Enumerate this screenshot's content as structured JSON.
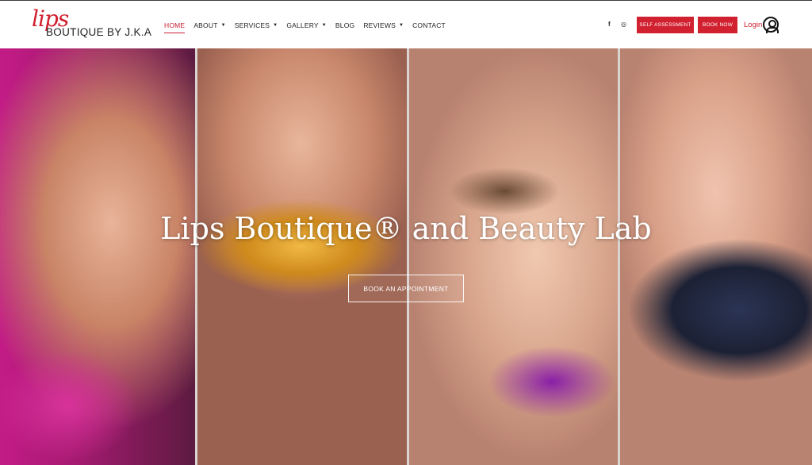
{
  "header": {
    "logo": {
      "script": "lips",
      "text": "BOUTIQUE BY J.K.A"
    },
    "nav": [
      {
        "label": "HOME",
        "has_dropdown": false,
        "active": true
      },
      {
        "label": "ABOUT",
        "has_dropdown": true
      },
      {
        "label": "SERVICES",
        "has_dropdown": true
      },
      {
        "label": "GALLERY",
        "has_dropdown": true
      },
      {
        "label": "BLOG",
        "has_dropdown": false
      },
      {
        "label": "REVIEWS",
        "has_dropdown": true
      },
      {
        "label": "CONTACT",
        "has_dropdown": false
      }
    ],
    "social": {
      "facebook": "f",
      "instagram": "◎"
    },
    "self_assessment_label": "SELF ASSESSMENT",
    "book_now_label": "BOOK NOW",
    "login_label": "Login",
    "caret": "▼"
  },
  "hero": {
    "title": "Lips Boutique® and Beauty Lab",
    "button_label": "BOOK AN APPOINTMENT"
  },
  "colors": {
    "accent": "#d1202f",
    "text": "#222222",
    "hero_text": "#ffffff"
  }
}
